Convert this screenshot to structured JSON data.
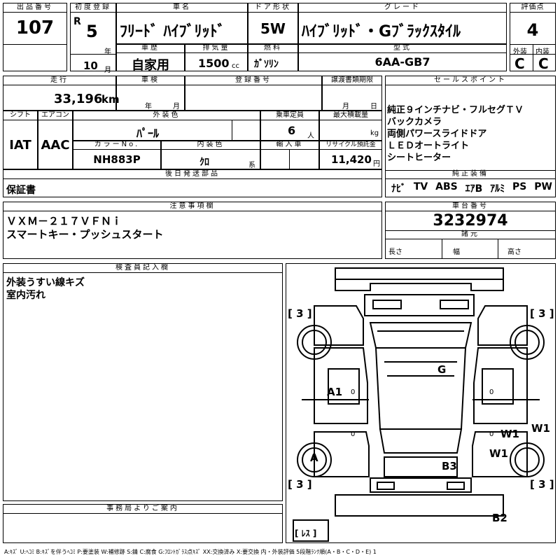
{
  "labels": {
    "lot_no": "出品番号",
    "first_reg": "初度登録",
    "car_name": "車名",
    "door_type": "ドア形状",
    "grade": "グレード",
    "score": "評価点",
    "car_history": "車歴",
    "displacement": "排気量",
    "fuel": "燃料",
    "model_code": "型式",
    "exterior": "外装",
    "interior": "内装",
    "mileage": "走行",
    "shaken": "車検",
    "reg_no": "登録番号",
    "transfer_deadline": "譲渡書類期限",
    "sales_points": "セールスポイント",
    "shift": "シフト",
    "aircon": "エアコン",
    "ext_color": "外装色",
    "capacity": "乗車定員",
    "max_load": "最大積載量",
    "color_no": "カラーNo.",
    "int_color": "内装色",
    "imported": "輸入車",
    "recycle": "リサイクル預託金",
    "followup_parts": "後日発送部品",
    "oem_equipment": "純正装備",
    "notes": "注意事項欄",
    "chassis_no": "車台番号",
    "dimensions": "諸元",
    "length": "長さ",
    "width": "幅",
    "height": "高さ",
    "inspector": "検査員記入欄",
    "office_info": "事務局よりご案内"
  },
  "units": {
    "era": "R",
    "year": "年",
    "month": "月",
    "cc": "cc",
    "km": "km",
    "shaken_year": "年",
    "shaken_month": "月",
    "deadline_month": "月",
    "deadline_day": "日",
    "persons": "人",
    "kg": "kg",
    "kei": "系",
    "yen": "円"
  },
  "values": {
    "lot_no": "107",
    "reg_year": "5",
    "reg_month": "10",
    "car_name": "ﾌﾘｰﾄﾞ ﾊｲﾌﾞﾘｯﾄﾞ",
    "door_type": "5W",
    "grade": "ﾊｲﾌﾞﾘｯﾄﾞ・Gﾌﾞﾗｯｸｽﾀｲﾙ",
    "score": "4",
    "car_history": "自家用",
    "displacement": "1500",
    "fuel": "ｶﾞｿﾘﾝ",
    "model_code": "6AA-GB7",
    "exterior_grade": "C",
    "interior_grade": "C",
    "mileage": "33,196",
    "shift": "IAT",
    "aircon": "AAC",
    "ext_color": "ﾊﾟｰﾙ",
    "capacity": "6",
    "color_no": "NH883P",
    "int_color": "ｸﾛ",
    "recycle": "11,420",
    "followup_parts": "保証書",
    "chassis_no": "3232974"
  },
  "sales_points": [
    "純正９インチナビ・フルセグＴＶ",
    "バックカメラ",
    "両側パワースライドドア",
    "ＬＥＤオートライト",
    "シートヒーター"
  ],
  "equipment": [
    "ﾅﾋﾞ",
    "TV",
    "ABS",
    "ｴｱB",
    "ｱﾙﾐ",
    "PS",
    "PW"
  ],
  "notes": [
    "ＶＸＭ－２１７ＶＦＮｉ",
    "スマートキー・プッシュスタート"
  ],
  "inspector_notes": [
    "外装うすい線キズ",
    "室内汚れ"
  ],
  "diagram": {
    "tire_fl": "[ 3 ]",
    "tire_fr": "[ 3 ]",
    "tire_rl": "[ 3 ]",
    "tire_rr": "[ 3 ]",
    "marks": {
      "g": "G",
      "a1": "A1",
      "w1_a": "W1",
      "w1_b": "W1",
      "w1_c": "W1",
      "a": "A",
      "b3": "B3",
      "b2": "B2"
    },
    "spare": "[ ﾚｽ ]"
  },
  "legend": "A:ｷｽﾞ U:ﾍｺﾐ B:ｷｽﾞを伴うﾍｺﾐ P:要塗装 W:補修跡 S:錆 C:腐食 G:ﾌﾛﾝﾄｶﾞﾗｽ点ｷｽﾞ XX:交換済み X:要交換 内・外装評価 5段階ﾗﾝｸ順(A・B・C・D・E) 1"
}
